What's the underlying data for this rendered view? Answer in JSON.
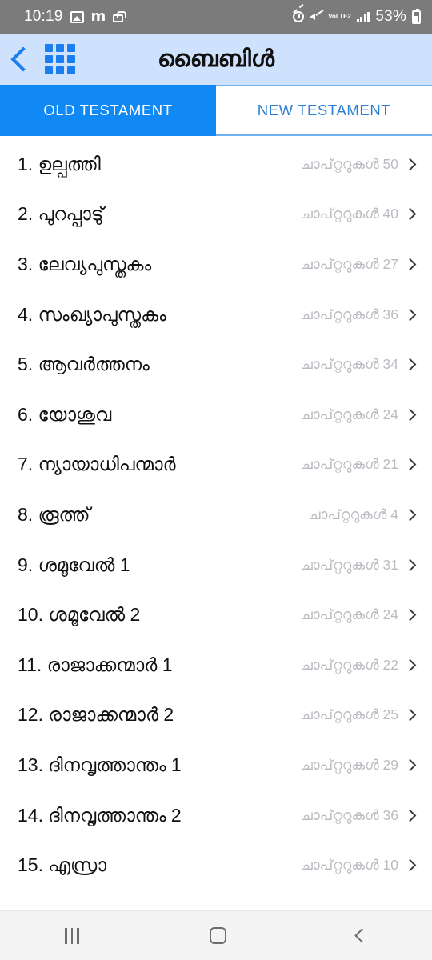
{
  "status_bar": {
    "time": "10:19",
    "battery_percent": "53%",
    "network_label": "VoLTE2",
    "left_icons": [
      "image-icon",
      "m-icon",
      "lock-icon"
    ],
    "right_icons": [
      "alarm-icon",
      "mute-icon",
      "volte-icon",
      "signal-bars-icon",
      "battery-icon"
    ]
  },
  "app_bar": {
    "back_icon": "back-chevron-icon",
    "grid_icon": "grid-menu-icon",
    "title": "ബൈബിൾ",
    "background_color": "#cfe2fd"
  },
  "tabs": {
    "active_color": "#1089f5",
    "inactive_color": "#2d7fd4",
    "items": [
      {
        "label": "OLD TESTAMENT",
        "active": true
      },
      {
        "label": "NEW TESTAMENT",
        "active": false
      }
    ]
  },
  "book_list": {
    "chapters_word": "ചാപ്റ്ററുകൾ",
    "rows": [
      {
        "index": "1.",
        "name": "ഉല്പത്തി",
        "meta": "ചാപ്റ്ററുകൾ 50"
      },
      {
        "index": "2.",
        "name": "പുറപ്പാടു്",
        "meta": "ചാപ്റ്ററുകൾ 40"
      },
      {
        "index": "3.",
        "name": "ലേവ്യപുസ്തകം",
        "meta": "ചാപ്റ്ററുകൾ 27"
      },
      {
        "index": "4.",
        "name": "സംഖ്യാപുസ്തകം",
        "meta": "ചാപ്റ്ററുകൾ 36"
      },
      {
        "index": "5.",
        "name": "ആവർത്തനം",
        "meta": "ചാപ്റ്ററുകൾ 34"
      },
      {
        "index": "6.",
        "name": "യോശുവ",
        "meta": "ചാപ്റ്ററുകൾ 24"
      },
      {
        "index": "7.",
        "name": "ന്യായാധിപന്മാർ",
        "meta": "ചാപ്റ്ററുകൾ 21"
      },
      {
        "index": "8.",
        "name": "രൂത്ത്",
        "meta": "ചാപ്റ്ററുകൾ 4"
      },
      {
        "index": "9.",
        "name": "ശമൂവേൽ 1",
        "meta": "ചാപ്റ്ററുകൾ 31"
      },
      {
        "index": "10.",
        "name": "ശമൂവേൽ 2",
        "meta": "ചാപ്റ്ററുകൾ 24"
      },
      {
        "index": "11.",
        "name": "രാജാക്കന്മാർ 1",
        "meta": "ചാപ്റ്ററുകൾ 22"
      },
      {
        "index": "12.",
        "name": "രാജാക്കന്മാർ 2",
        "meta": "ചാപ്റ്ററുകൾ 25"
      },
      {
        "index": "13.",
        "name": "ദിനവൃത്താന്തം 1",
        "meta": "ചാപ്റ്ററുകൾ 29"
      },
      {
        "index": "14.",
        "name": "ദിനവൃത്താന്തം 2",
        "meta": "ചാപ്റ്ററുകൾ 36"
      },
      {
        "index": "15.",
        "name": "എസ്രാ",
        "meta": "ചാപ്റ്ററുകൾ 10"
      }
    ]
  },
  "nav_bar": {
    "items": [
      "recents-icon",
      "home-icon",
      "back-icon"
    ]
  }
}
